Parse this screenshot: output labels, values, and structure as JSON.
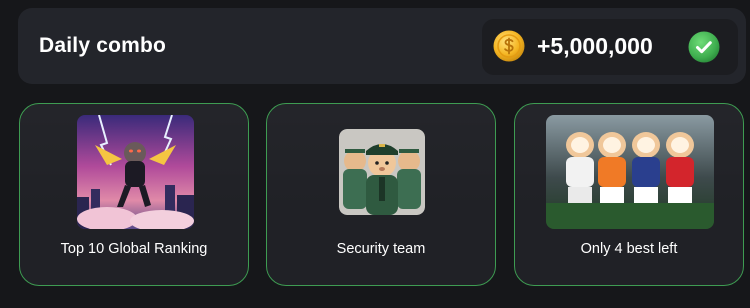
{
  "header": {
    "title": "Daily combo",
    "reward": "+5,000,000",
    "coin_icon": "gold-coin-icon",
    "check_icon": "check-circle-icon"
  },
  "cards": [
    {
      "label": "Top 10 Global Ranking",
      "image": "hamster-hero-illustration"
    },
    {
      "label": "Security team",
      "image": "hamster-security-guards-illustration"
    },
    {
      "label": "Only 4 best left",
      "image": "hamster-football-team-illustration"
    }
  ],
  "colors": {
    "background": "#16171a",
    "header_bg": "#23252b",
    "pill_bg": "#1c1d21",
    "card_border": "#3e9c52",
    "check_green": "#3fae4f",
    "coin_gold": "#f5b623"
  }
}
